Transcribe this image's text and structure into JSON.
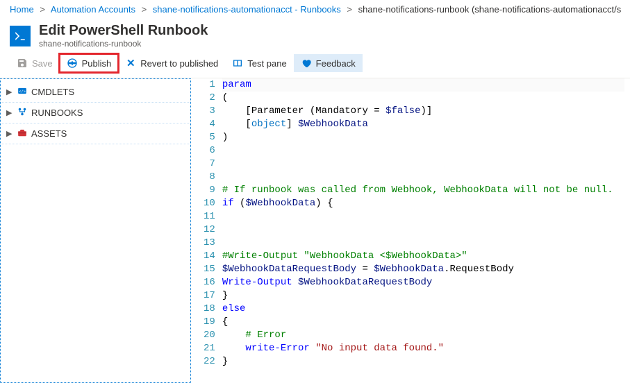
{
  "breadcrumb": {
    "home": "Home",
    "automation_accounts": "Automation Accounts",
    "acct": "shane-notifications-automationacct - Runbooks",
    "runbook": "shane-notifications-runbook (shane-notifications-automationacct/s"
  },
  "header": {
    "title": "Edit PowerShell Runbook",
    "subtitle": "shane-notifications-runbook"
  },
  "toolbar": {
    "save": "Save",
    "publish": "Publish",
    "revert": "Revert to published",
    "testpane": "Test pane",
    "feedback": "Feedback"
  },
  "sidebar": {
    "items": [
      {
        "label": "CMDLETS",
        "icon": "code-tag-icon"
      },
      {
        "label": "RUNBOOKS",
        "icon": "flow-icon"
      },
      {
        "label": "ASSETS",
        "icon": "toolbox-icon"
      }
    ]
  },
  "code": {
    "lines": [
      {
        "n": 1,
        "seg": [
          [
            "kw",
            "param"
          ]
        ]
      },
      {
        "n": 2,
        "seg": [
          [
            "plain",
            "("
          ]
        ]
      },
      {
        "n": 3,
        "seg": [
          [
            "plain",
            "    [Parameter (Mandatory = "
          ],
          [
            "var",
            "$false"
          ],
          [
            "plain",
            ")]"
          ]
        ]
      },
      {
        "n": 4,
        "seg": [
          [
            "plain",
            "    ["
          ],
          [
            "type",
            "object"
          ],
          [
            "plain",
            "] "
          ],
          [
            "var",
            "$WebhookData"
          ]
        ]
      },
      {
        "n": 5,
        "seg": [
          [
            "plain",
            ")"
          ]
        ]
      },
      {
        "n": 6,
        "seg": []
      },
      {
        "n": 7,
        "seg": []
      },
      {
        "n": 8,
        "seg": []
      },
      {
        "n": 9,
        "seg": [
          [
            "cmt",
            "# If runbook was called from Webhook, WebhookData will not be null."
          ]
        ]
      },
      {
        "n": 10,
        "seg": [
          [
            "kw",
            "if"
          ],
          [
            "plain",
            " ("
          ],
          [
            "var",
            "$WebhookData"
          ],
          [
            "plain",
            ") {"
          ]
        ]
      },
      {
        "n": 11,
        "seg": []
      },
      {
        "n": 12,
        "seg": []
      },
      {
        "n": 13,
        "seg": []
      },
      {
        "n": 14,
        "seg": [
          [
            "cmt",
            "#Write-Output \"WebhookData <$WebhookData>\""
          ]
        ]
      },
      {
        "n": 15,
        "seg": [
          [
            "var",
            "$WebhookDataRequestBody"
          ],
          [
            "plain",
            " = "
          ],
          [
            "var",
            "$WebhookData"
          ],
          [
            "plain",
            ".RequestBody"
          ]
        ]
      },
      {
        "n": 16,
        "seg": [
          [
            "cmd",
            "Write-Output"
          ],
          [
            "plain",
            " "
          ],
          [
            "var",
            "$WebhookDataRequestBody"
          ]
        ]
      },
      {
        "n": 17,
        "seg": [
          [
            "plain",
            "}"
          ]
        ]
      },
      {
        "n": 18,
        "seg": [
          [
            "kw",
            "else"
          ]
        ]
      },
      {
        "n": 19,
        "seg": [
          [
            "plain",
            "{"
          ]
        ]
      },
      {
        "n": 20,
        "seg": [
          [
            "plain",
            "    "
          ],
          [
            "cmt",
            "# Error"
          ]
        ]
      },
      {
        "n": 21,
        "seg": [
          [
            "plain",
            "    "
          ],
          [
            "cmd",
            "write-Error"
          ],
          [
            "plain",
            " "
          ],
          [
            "str",
            "\"No input data found.\""
          ]
        ]
      },
      {
        "n": 22,
        "seg": [
          [
            "plain",
            "}"
          ]
        ]
      }
    ]
  }
}
